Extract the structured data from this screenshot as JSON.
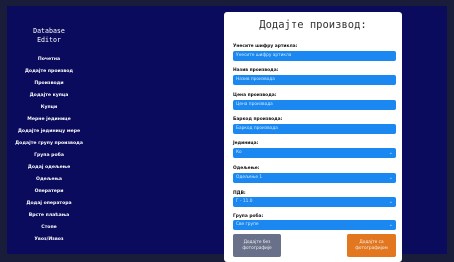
{
  "sidebar": {
    "title_line1": "Database",
    "title_line2": "Editor",
    "items": [
      "Почетна",
      "Додајте производ",
      "Производи",
      "Додајте купца",
      "Купци",
      "Мерне јединице",
      "Додајте јединицу мере",
      "Додајте групу производа",
      "Група роба",
      "Додај одељење",
      "Одељења",
      "Оператери",
      "Додај оператора",
      "Врсте плаћања",
      "Стопе",
      "Увоз/Извоз"
    ]
  },
  "form": {
    "title": "Додајте производ:",
    "barcode_label": "Унесите шифру артикла:",
    "barcode_placeholder": "Унесите шифру артикла",
    "name_label": "Назив производа:",
    "name_placeholder": "Назив производа",
    "price_label": "Цена производа:",
    "price_placeholder": "Цена производа",
    "ean_label": "Баркод производа:",
    "ean_placeholder": "Баркод производа",
    "unit_label": "Јединица:",
    "unit_value": "Ко",
    "department_label": "Одељење:",
    "department_value": "Одељење 1",
    "vat_label": "ПДВ:",
    "vat_value": "Г - 11.0",
    "group_label": "Група роба:",
    "group_value": "Све групе",
    "btn_no_photo_line1": "Додајте без",
    "btn_no_photo_line2": "фотографије",
    "btn_photo_line1": "Додајте са",
    "btn_photo_line2": "фотографијом"
  },
  "icons": {
    "select_arrow": "chevron-down-icon"
  },
  "colors": {
    "background": "#0a0b5c",
    "field": "#1a88f0",
    "btn_gray": "#69708a",
    "btn_orange": "#e2771f"
  }
}
